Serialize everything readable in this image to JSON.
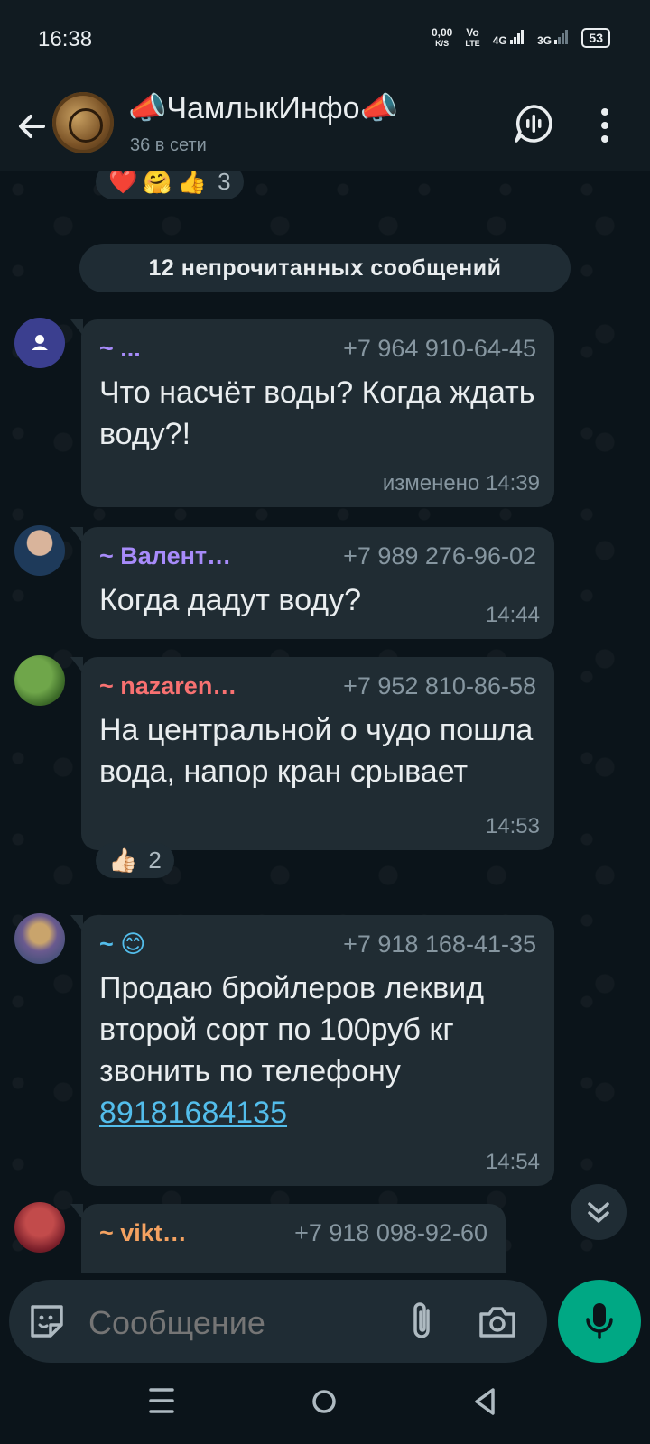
{
  "status": {
    "time": "16:38",
    "speed": "0,00",
    "speed_unit": "K/S",
    "volte_top": "Vo",
    "volte_bottom": "LTE",
    "net1": "4G",
    "net2": "3G",
    "battery": "53"
  },
  "header": {
    "title": "📣ЧамлыкИнфо📣",
    "subtitle": "36 в сети"
  },
  "top_reaction": {
    "emojis": [
      "❤️",
      "🤗",
      "👍"
    ],
    "count": "3"
  },
  "unread_label": "12 непрочитанных сообщений",
  "messages": [
    {
      "sender": "~ ...",
      "sender_color": "#a78bfa",
      "phone": "+7 964 910-64-45",
      "text": "Что насчёт воды? Когда ждать воду?!",
      "time": "изменено 14:39"
    },
    {
      "sender": "~ Валент…",
      "sender_color": "#a78bfa",
      "phone": "+7 989 276-96-02",
      "text": "Когда дадут воду?",
      "time": "14:44"
    },
    {
      "sender": "~ nazaren…",
      "sender_color": "#f87171",
      "phone": "+7 952 810-86-58",
      "text": "На центральной о чудо пошла вода, напор кран срывает",
      "time": "14:53",
      "reaction": {
        "emoji": "👍🏻",
        "count": "2"
      }
    },
    {
      "sender": "~ 😊",
      "sender_color": "#53bdeb",
      "phone": "+7 918 168-41-35",
      "text": "Продаю бройлеров леквид второй сорт по 100руб кг звонить по телефону",
      "link": "89181684135",
      "time": "14:54"
    },
    {
      "sender": "~ vikt…",
      "sender_color": "#f4a261",
      "phone": "+7 918 098-92-60"
    }
  ],
  "composer": {
    "placeholder": "Сообщение"
  },
  "colors": {
    "accent": "#00a884",
    "bubble": "#202c33",
    "background": "#0b141a"
  }
}
